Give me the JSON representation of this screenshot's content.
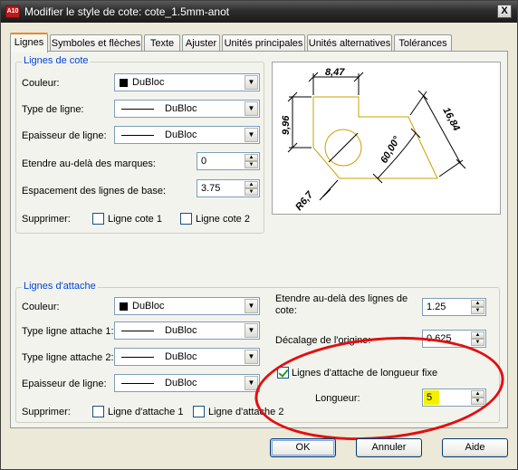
{
  "window": {
    "title": "Modifier le style de cote: cote_1.5mm-anot",
    "app_icon": "A10",
    "close_glyph": "X"
  },
  "tabs": [
    {
      "label": "Lignes",
      "active": true
    },
    {
      "label": "Symboles et flèches",
      "active": false
    },
    {
      "label": "Texte",
      "active": false
    },
    {
      "label": "Ajuster",
      "active": false
    },
    {
      "label": "Unités principales",
      "active": false
    },
    {
      "label": "Unités alternatives",
      "active": false
    },
    {
      "label": "Tolérances",
      "active": false
    }
  ],
  "dim_lines": {
    "title": "Lignes de cote",
    "color_label": "Couleur:",
    "color_value": "DuBloc",
    "linetype_label": "Type de ligne:",
    "linetype_value": "DuBloc",
    "lineweight_label": "Epaisseur de ligne:",
    "lineweight_value": "DuBloc",
    "extend_label": "Etendre au-delà des marques:",
    "extend_value": "0",
    "baseline_label": "Espacement des lignes de base:",
    "baseline_value": "3.75",
    "suppress_label": "Supprimer:",
    "suppress_1": "Ligne cote 1",
    "suppress_2": "Ligne cote 2"
  },
  "preview": {
    "dim_top": "8,47",
    "dim_left": "9,96",
    "dim_right": "16,84",
    "dim_angle": "60,00°",
    "dim_radius": "R6,7"
  },
  "ext_lines": {
    "title": "Lignes d'attache",
    "color_label": "Couleur:",
    "color_value": "DuBloc",
    "type1_label": "Type ligne attache 1:",
    "type1_value": "DuBloc",
    "type2_label": "Type ligne attache 2:",
    "type2_value": "DuBloc",
    "lineweight_label": "Epaisseur de ligne:",
    "lineweight_value": "DuBloc",
    "suppress_label": "Supprimer:",
    "suppress_1": "Ligne d'attache 1",
    "suppress_2": "Ligne d'attache 2",
    "extend_label": "Etendre au-delà des lignes de cote:",
    "extend_value": "1.25",
    "offset_label": "Décalage de l'origine:",
    "offset_value": "0.625",
    "fixed_label": "Lignes d'attache de longueur fixe",
    "fixed_checked": true,
    "length_label": "Longueur:",
    "length_value": "5"
  },
  "buttons": {
    "ok": "OK",
    "cancel": "Annuler",
    "help": "Aide"
  },
  "colors": {
    "group_title": "#0046d5",
    "annotation_ellipse": "#e01010",
    "highlight": "#f4f100",
    "preview_shape": "#c8a000"
  },
  "icons": {
    "dropdown": "triangle-down",
    "spin_up": "triangle-up",
    "spin_down": "triangle-down"
  }
}
